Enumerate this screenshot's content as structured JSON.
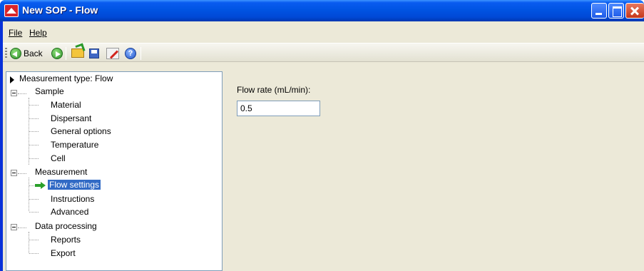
{
  "window": {
    "title": "New SOP - Flow"
  },
  "menu": {
    "file": "File",
    "help": "Help"
  },
  "toolbar": {
    "back_label": "Back",
    "info_glyph": "?"
  },
  "tree": {
    "root": "Measurement type: Flow",
    "groups": [
      {
        "label": "Sample",
        "children": [
          "Material",
          "Dispersant",
          "General options",
          "Temperature",
          "Cell"
        ]
      },
      {
        "label": "Measurement",
        "children": [
          "Flow settings",
          "Instructions",
          "Advanced"
        ]
      },
      {
        "label": "Data processing",
        "children": [
          "Reports",
          "Export"
        ]
      }
    ],
    "selected": "Flow settings"
  },
  "panel": {
    "flow_rate_label": "Flow rate (mL/min):",
    "flow_rate_value": "0.5"
  },
  "colors": {
    "selection": "#316ac5",
    "titlebar": "#0054e3"
  }
}
